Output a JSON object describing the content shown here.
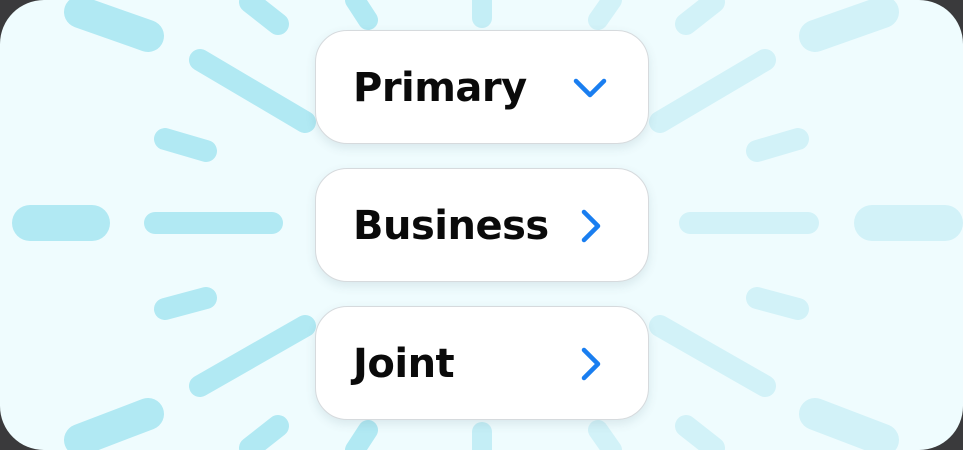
{
  "colors": {
    "accent": "#1a7ef0",
    "background": "#effcfe",
    "ray_strong": "#b1e9f3",
    "ray_light": "#d2f2f8"
  },
  "account_types": {
    "options": [
      {
        "label": "Primary",
        "icon": "chevron-down-icon",
        "state": "expanded"
      },
      {
        "label": "Business",
        "icon": "chevron-right-icon",
        "state": "collapsed"
      },
      {
        "label": "Joint",
        "icon": "chevron-right-icon",
        "state": "collapsed"
      }
    ]
  }
}
